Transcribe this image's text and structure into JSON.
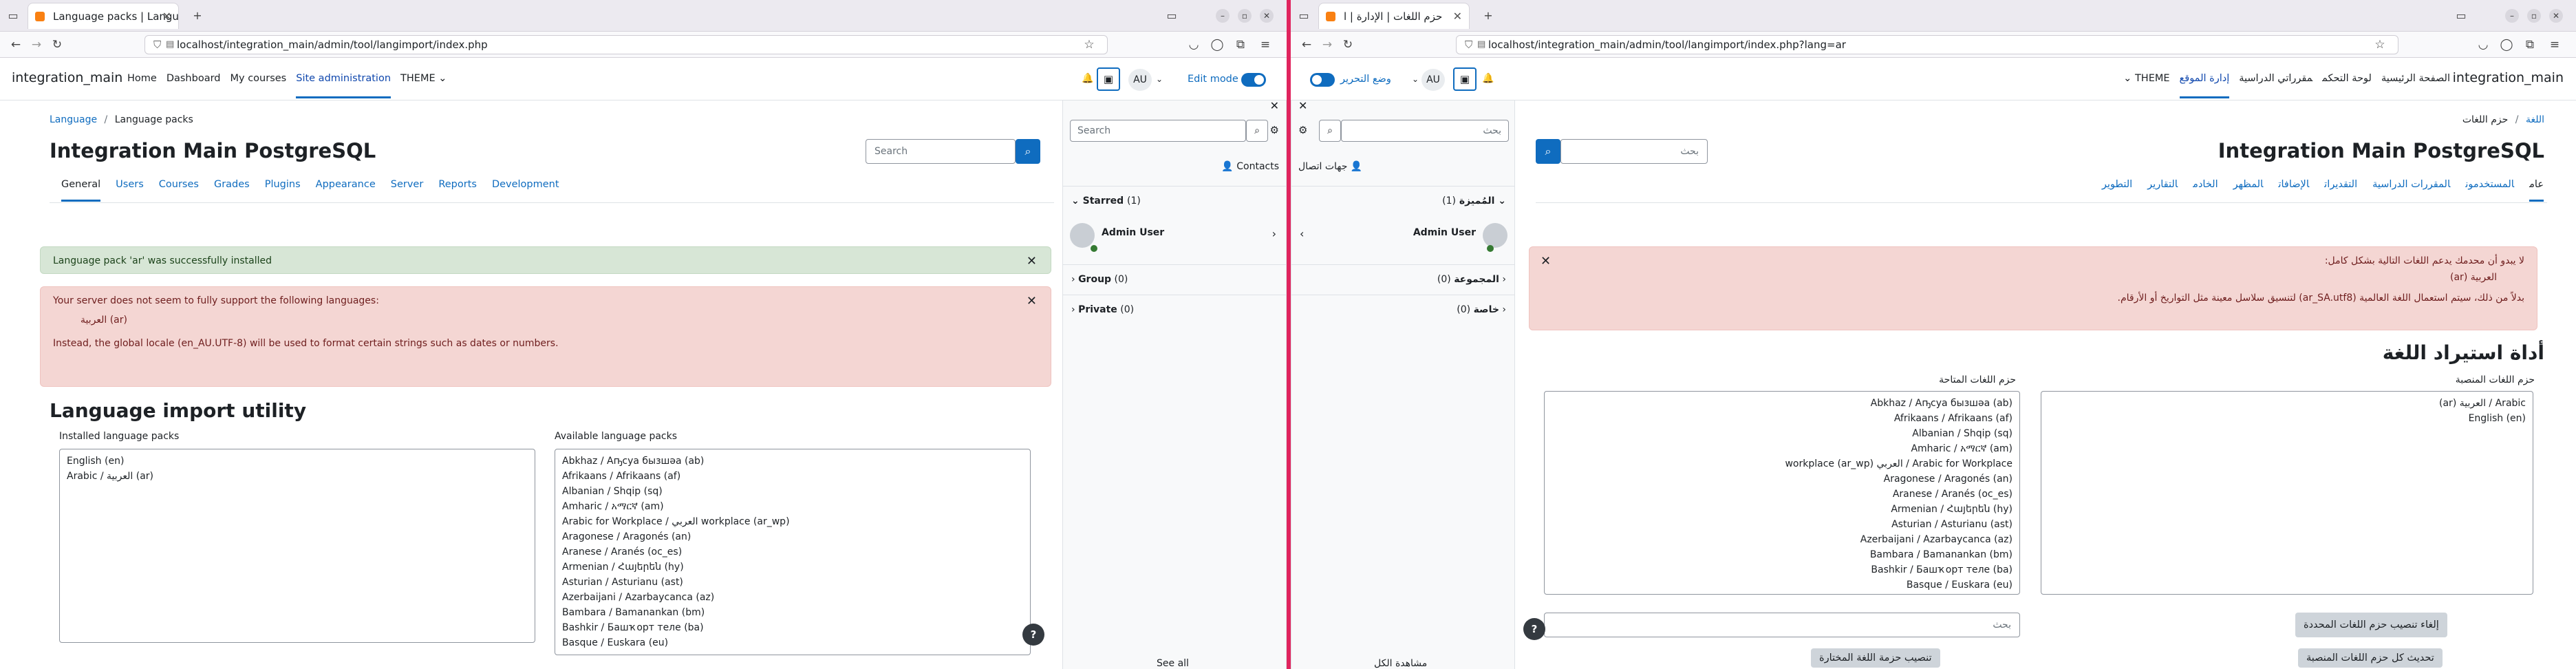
{
  "left": {
    "tab_title": "Language packs | Langu",
    "url": "localhost/integration_main/admin/tool/langimport/index.php",
    "brand": "integration_main",
    "nav": [
      "Home",
      "Dashboard",
      "My courses",
      "Site administration",
      "THEME ⌄"
    ],
    "avatar": "AU",
    "edit_mode": "Edit mode",
    "drawer": {
      "search_placeholder": "Search",
      "contacts": "Contacts",
      "starred": "Starred",
      "starred_count": "(1)",
      "user": "Admin User",
      "group": "Group",
      "group_count": "(0)",
      "private": "Private",
      "private_count": "(0)",
      "see_all": "See all"
    },
    "breadcrumb": {
      "a": "Language",
      "sep": "/",
      "b": "Language packs"
    },
    "title": "Integration Main PostgreSQL",
    "search_placeholder": "Search",
    "tabs": [
      "General",
      "Users",
      "Courses",
      "Grades",
      "Plugins",
      "Appearance",
      "Server",
      "Reports",
      "Development"
    ],
    "success": "Language pack 'ar' was successfully installed",
    "warning": {
      "line1": "Your server does not seem to fully support the following languages:",
      "item": "العربية (ar)",
      "line2": "Instead, the global locale (en_AU.UTF-8) will be used to format certain strings such as dates or numbers."
    },
    "heading": "Language import utility",
    "installed_label": "Installed language packs",
    "installed": [
      "English (en)",
      "Arabic / العربية (ar)"
    ],
    "available_label": "Available language packs",
    "available": [
      "Abkhaz / Аҧсуа бызшәа (ab)",
      "Afrikaans / Afrikaans (af)",
      "Albanian / Shqip (sq)",
      "Amharic / አማርኛ (am)",
      "Arabic for Workplace / العربي workplace (ar_wp)",
      "Aragonese / Aragonés (an)",
      "Aranese / Aranés (oc_es)",
      "Armenian / Հայերեն (hy)",
      "Asturian / Asturianu (ast)",
      "Azerbaijani / Azarbaycanca (az)",
      "Bambara / Bamanankan (bm)",
      "Bashkir / Башҡорт теле (ba)",
      "Basque / Euskara (eu)"
    ],
    "help": "?"
  },
  "right": {
    "tab_title": "حزم اللغات | الإدارة | ا",
    "url": "localhost/integration_main/admin/tool/langimport/index.php?lang=ar",
    "brand": "integration_main",
    "nav": [
      "الصفحة الرئيسية",
      "لوحة التحكم",
      "مقرراتي الدراسية",
      "إدارة الموقع",
      "THEME ⌄"
    ],
    "avatar": "AU",
    "edit_mode": "وضع التحرير",
    "drawer": {
      "search_placeholder": "بحث",
      "contacts": "جهات اتصال",
      "starred": "المُميزة",
      "starred_count": "(1)",
      "user": "Admin User",
      "group": "المجموعة",
      "group_count": "(0)",
      "private": "خاصة",
      "private_count": "(0)",
      "see_all": "مشاهدة الكل"
    },
    "breadcrumb": {
      "a": "اللغة",
      "sep": "/",
      "b": "حزم اللغات"
    },
    "title": "Integration Main PostgreSQL",
    "search_placeholder": "بحث",
    "tabs": [
      "عام",
      "المستخدمون",
      "المقررات الدراسية",
      "التقديرات",
      "الإضافات",
      "المظهر",
      "الخادم",
      "التقارير",
      "التطوير"
    ],
    "warning": {
      "line1": "لا يبدو أن محدمك يدعم اللغات التالية بشكل كامل:",
      "item": "العربية (ar)",
      "line2": "بدلاً من ذلك، سيتم استعمال اللغة العالمية (ar_SA.utf8) لتنسيق سلاسل معينة مثل التواريخ أو الأرقام."
    },
    "heading": "أداة استيراد اللغة",
    "installed_label": "حزم اللغات المنصبة",
    "installed": [
      "Arabic / العربية (ar)",
      "English (en)"
    ],
    "available_label": "حزم اللغات المتاحة",
    "available": [
      "Abkhaz / Аҧсуа бызшәа (ab)",
      "Afrikaans / Afrikaans (af)",
      "Albanian / Shqip (sq)",
      "Amharic / አማርኛ (am)",
      "Arabic for Workplace / العربي workplace (ar_wp)",
      "Aragonese / Aragonés (an)",
      "Aranese / Aranés (oc_es)",
      "Armenian / Հայերեն (hy)",
      "Asturian / Asturianu (ast)",
      "Azerbaijani / Azarbaycanca (az)",
      "Bambara / Bamanankan (bm)",
      "Bashkir / Башҡорт теле (ba)",
      "Basque / Euskara (eu)"
    ],
    "uninstall_btn": "إلغاء تنصيب حزم اللغات المحددة",
    "update_btn": "تحديث كل حزم اللغات المنصبة",
    "filter_placeholder": "بحث",
    "install_btn": "تنصيب حزمة اللغة المختارة",
    "help": "?"
  }
}
